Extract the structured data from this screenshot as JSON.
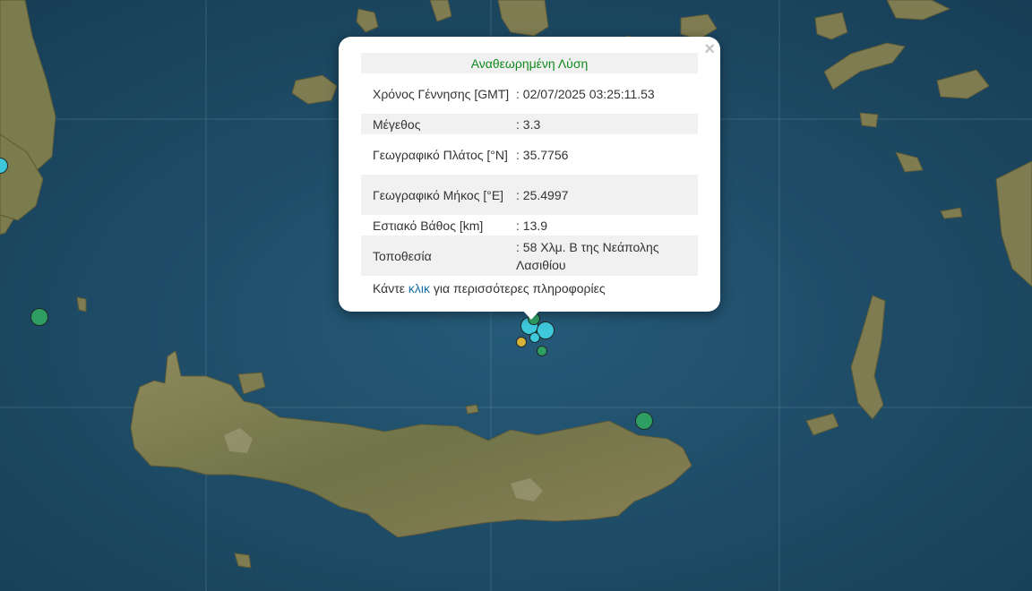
{
  "popup": {
    "title": "Αναθεωρημένη Λύση",
    "close_symbol": "×",
    "rows": [
      {
        "label": "Χρόνος Γέννησης [GMT]",
        "value": ": 02/07/2025 03:25:11.53"
      },
      {
        "label": "Μέγεθος",
        "value": ": 3.3"
      },
      {
        "label": "Γεωγραφικό Πλάτος [°N]",
        "value": ": 35.7756"
      },
      {
        "label": "Γεωγραφικό Μήκος [°E]",
        "value": ": 25.4997"
      },
      {
        "label": "Εστιακό Βάθος [km]",
        "value": ": 13.9"
      },
      {
        "label": "Τοποθεσία",
        "value": ": 58 Χλμ. Β της Νεάπολης Λασιθίου"
      }
    ],
    "more_prefix": "Κάντε ",
    "more_link": "κλικ",
    "more_suffix": " για περισσότερες πληροφορίες"
  },
  "colors": {
    "sea": "#1f4c66",
    "land": "#7d7a4e",
    "title_green": "#108a1c",
    "link_blue": "#1a6ea8",
    "marker_green": "#2e9e62",
    "marker_cyan": "#3fc7dc",
    "marker_yellow": "#d8b33a"
  }
}
